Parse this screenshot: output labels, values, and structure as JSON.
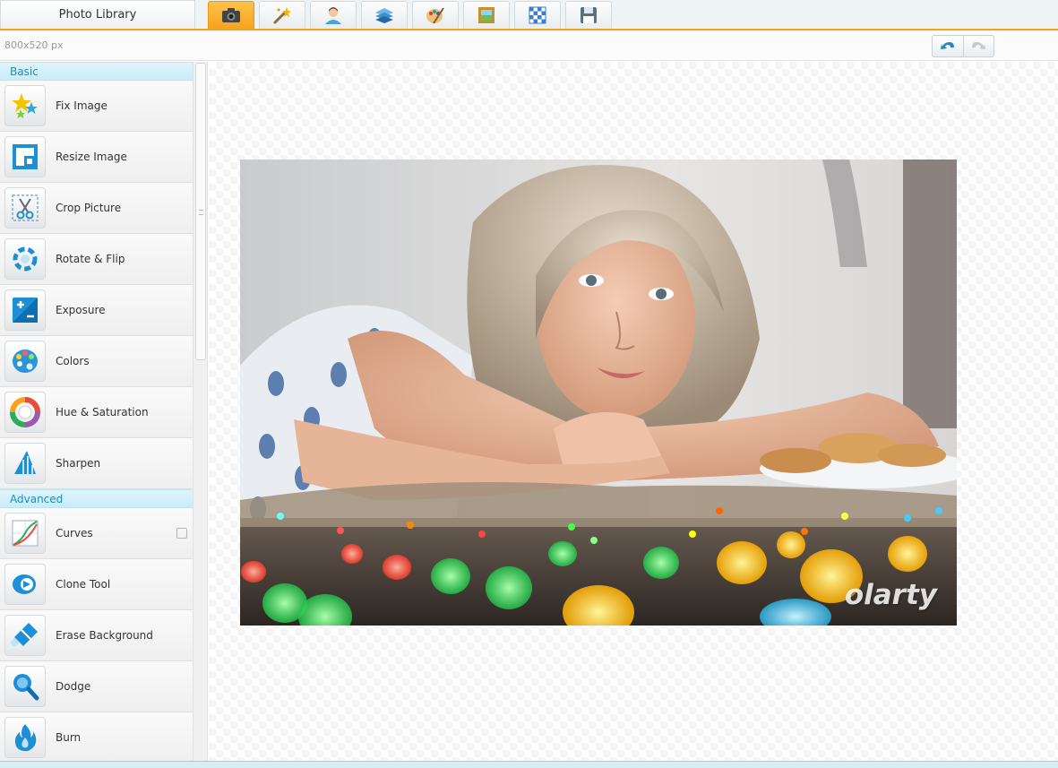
{
  "topbar": {
    "library_label": "Photo Library",
    "tabs": [
      {
        "icon": "camera-icon",
        "active": true
      },
      {
        "icon": "magic-wand-icon",
        "active": false
      },
      {
        "icon": "portrait-icon",
        "active": false
      },
      {
        "icon": "layers-icon",
        "active": false
      },
      {
        "icon": "palette-icon",
        "active": false
      },
      {
        "icon": "frame-icon",
        "active": false
      },
      {
        "icon": "transparency-icon",
        "active": false
      },
      {
        "icon": "save-icon",
        "active": false
      }
    ]
  },
  "subbar": {
    "dimensions": "800x520 px",
    "undo_icon": "undo-icon",
    "redo_icon": "redo-icon"
  },
  "sidebar": {
    "basic_label": "Basic",
    "basic_tools": [
      {
        "label": "Fix Image",
        "icon": "stars-icon"
      },
      {
        "label": "Resize Image",
        "icon": "resize-icon"
      },
      {
        "label": "Crop Picture",
        "icon": "scissors-icon"
      },
      {
        "label": "Rotate & Flip",
        "icon": "rotate-icon"
      },
      {
        "label": "Exposure",
        "icon": "exposure-icon"
      },
      {
        "label": "Colors",
        "icon": "palette-icon"
      },
      {
        "label": "Hue & Saturation",
        "icon": "color-wheel-icon"
      },
      {
        "label": "Sharpen",
        "icon": "sharpen-icon"
      }
    ],
    "advanced_label": "Advanced",
    "advanced_tools": [
      {
        "label": "Curves",
        "icon": "curves-icon"
      },
      {
        "label": "Clone Tool",
        "icon": "clone-icon"
      },
      {
        "label": "Erase Background",
        "icon": "eraser-icon"
      },
      {
        "label": "Dodge",
        "icon": "magnifier-icon"
      },
      {
        "label": "Burn",
        "icon": "flame-icon"
      }
    ]
  },
  "canvas": {
    "watermark": "olarty"
  },
  "colors": {
    "accent": "#f7a21b",
    "section_text": "#168fbf",
    "section_bg": "#d6f0fa"
  }
}
